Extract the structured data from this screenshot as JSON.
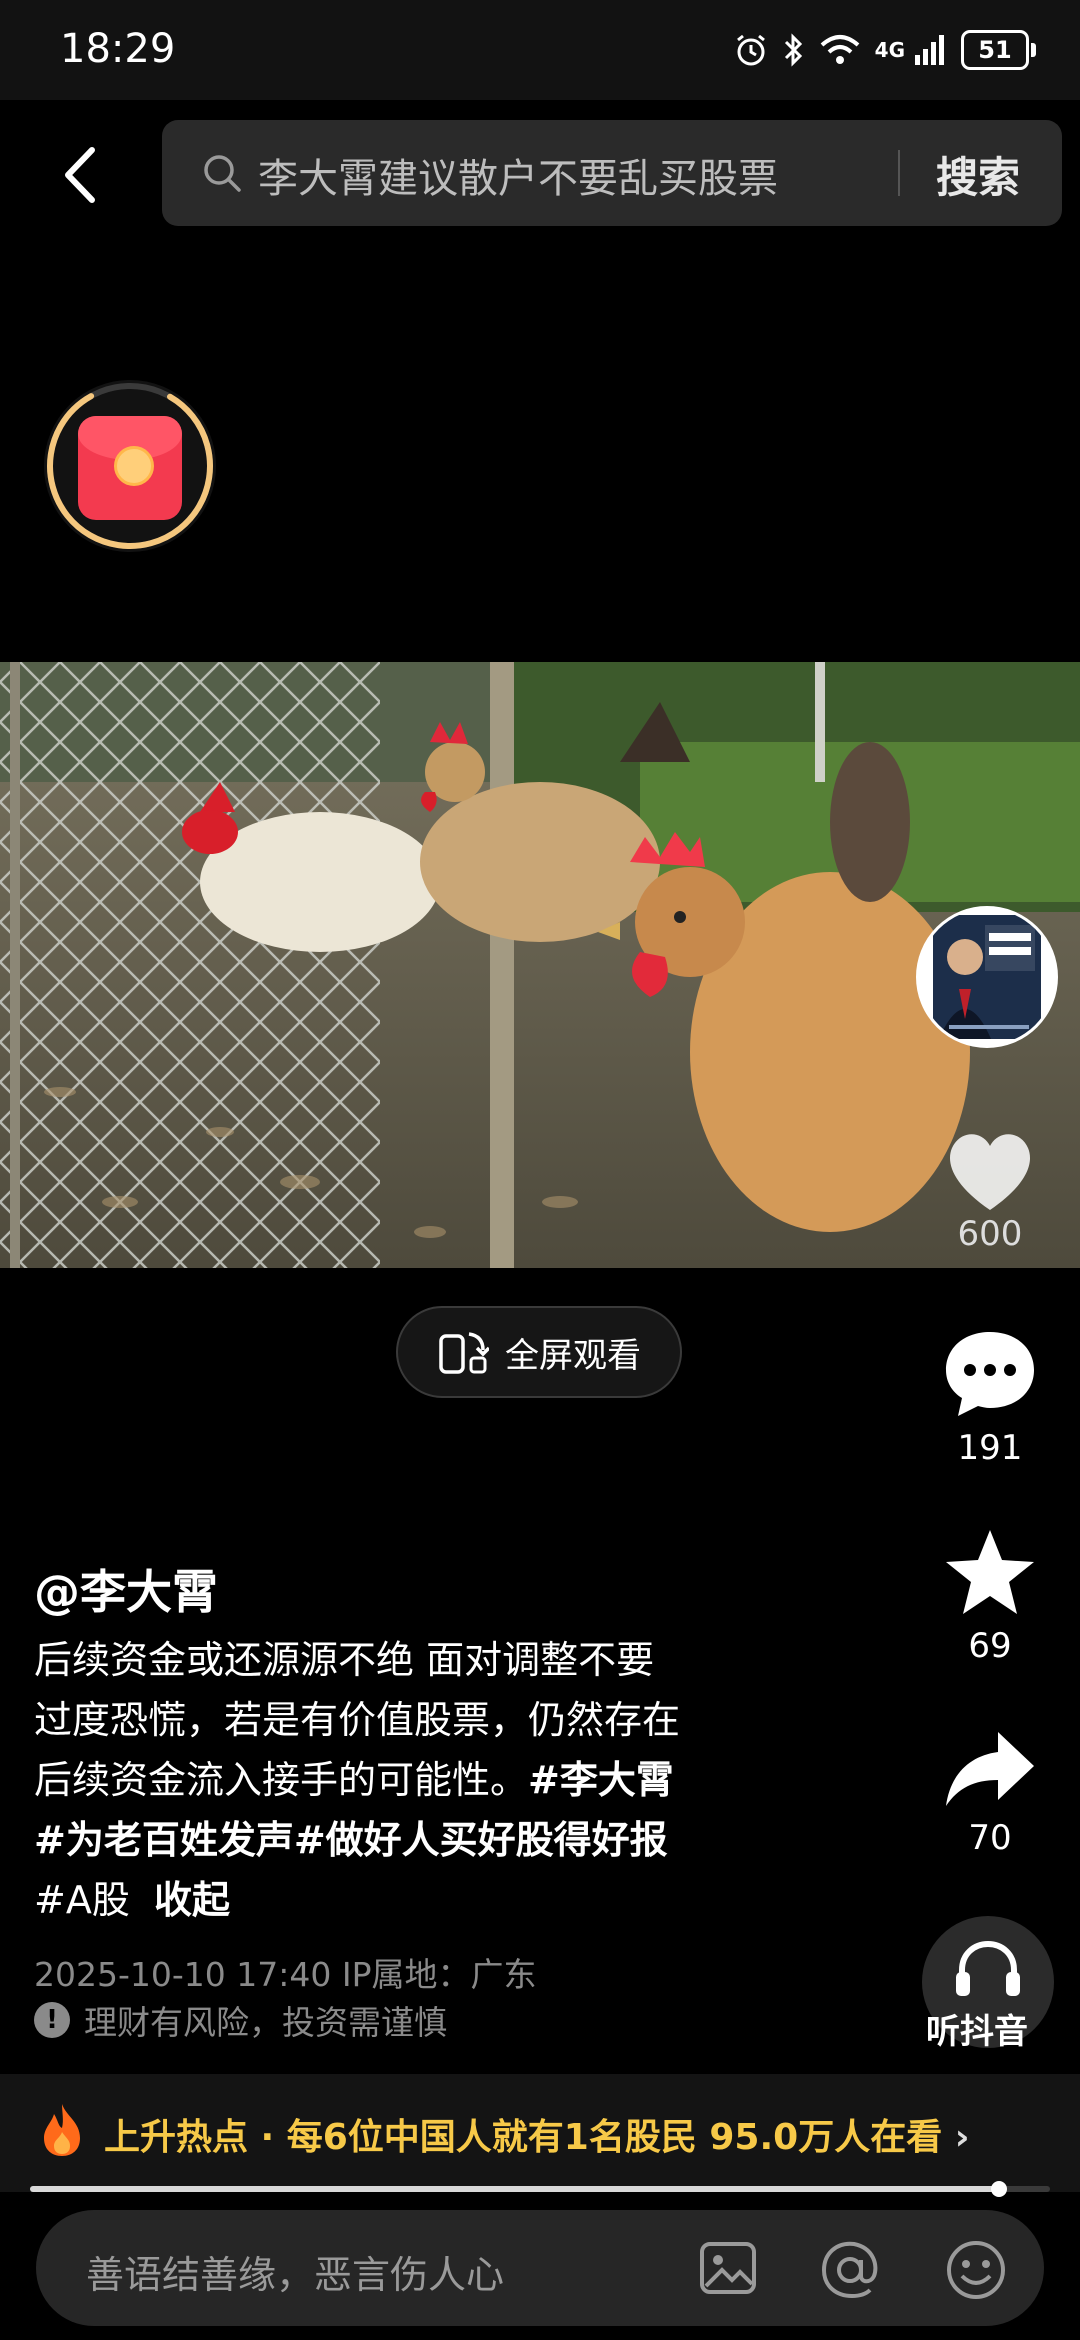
{
  "status_bar": {
    "time": "18:29",
    "network": "4G",
    "battery": "51"
  },
  "search": {
    "query": "李大霄建议散户不要乱买股票",
    "button_label": "搜索"
  },
  "video": {
    "fullscreen_label": "全屏观看",
    "progress": 0.95
  },
  "actions": {
    "likes": "600",
    "comments": "191",
    "favorites": "69",
    "shares": "70",
    "listen_label": "听抖音"
  },
  "post": {
    "author": "@李大霄",
    "text_line1": "后续资金或还源源不绝 面对调整不要",
    "text_line2": "过度恐慌，若是有价值股票，仍然存在",
    "text_line3": "后续资金流入接手的可能性。",
    "tag1": "#李大霄",
    "tag2": "#为老百姓发声",
    "tag3": "#做好人买好股得好报",
    "tag4": "#A股",
    "collapse_label": "收起",
    "meta": "2025-10-10 17:40  IP属地：广东",
    "risk_warning": "理财有风险，投资需谨慎"
  },
  "hot": {
    "text": "上升热点 · 每6位中国人就有1名股民  95.0万人在看",
    "chevron": "›"
  },
  "comment": {
    "placeholder": "善语结善缘，恶言伤人心"
  },
  "icons": {
    "accent_red": "#f33a4f",
    "hot_yellow": "#f7c948"
  }
}
